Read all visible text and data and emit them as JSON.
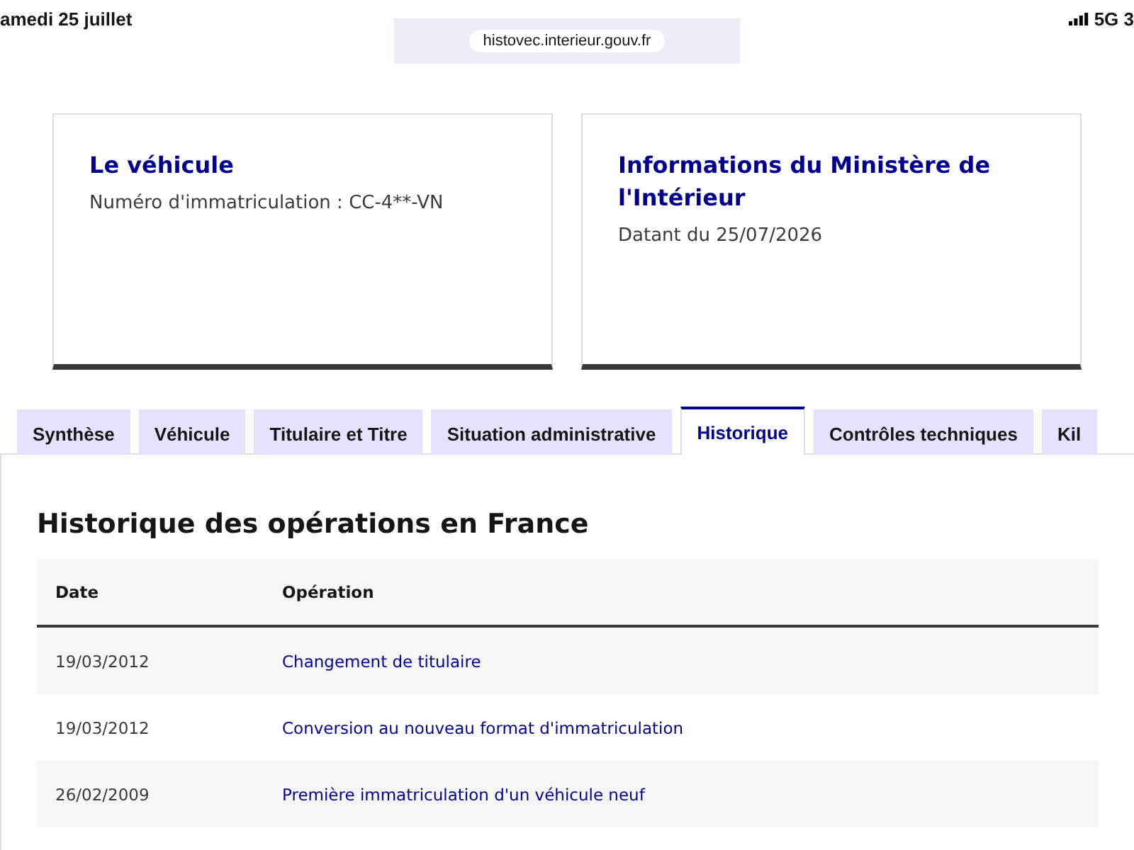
{
  "status_bar": {
    "date": "amedi 25 juillet",
    "network": "5G 3"
  },
  "address_bar": {
    "url": "histovec.interieur.gouv.fr"
  },
  "cards": [
    {
      "title": "Le véhicule",
      "text": "Numéro d'immatriculation : CC-4**-VN"
    },
    {
      "title": "Informations du Ministère de l'Intérieur",
      "text": "Datant du 25/07/2026"
    }
  ],
  "tabs": [
    {
      "label": "Synthèse",
      "selected": false
    },
    {
      "label": "Véhicule",
      "selected": false
    },
    {
      "label": "Titulaire et Titre",
      "selected": false
    },
    {
      "label": "Situation administrative",
      "selected": false
    },
    {
      "label": "Historique",
      "selected": true
    },
    {
      "label": "Contrôles techniques",
      "selected": false
    },
    {
      "label": "Kil",
      "selected": false
    }
  ],
  "panel": {
    "title": "Historique des opérations en France",
    "table": {
      "columns": [
        "Date",
        "Opération"
      ],
      "rows": [
        [
          "19/03/2012",
          "Changement de titulaire"
        ],
        [
          "19/03/2012",
          "Conversion au nouveau format d'immatriculation"
        ],
        [
          "26/02/2009",
          "Première immatriculation d'un véhicule neuf"
        ]
      ]
    }
  }
}
